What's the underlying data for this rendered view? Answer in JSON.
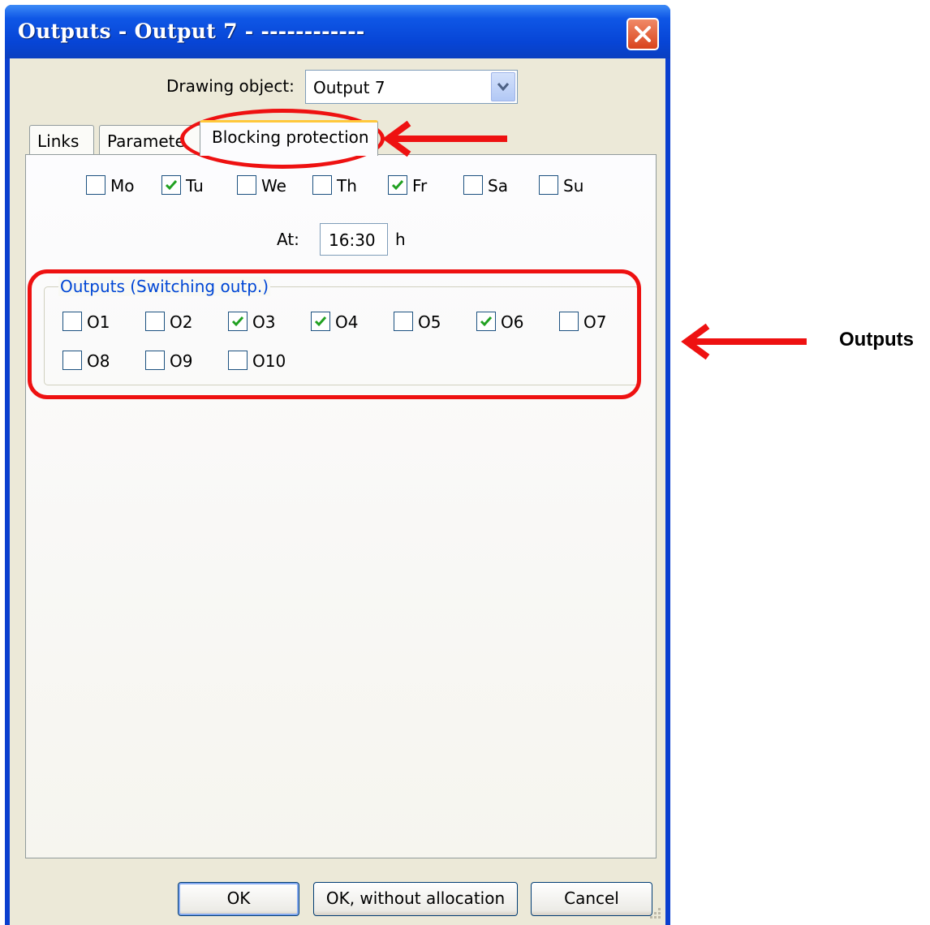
{
  "window": {
    "title": "Outputs - Output 7 - ------------"
  },
  "drawing_object": {
    "label": "Drawing object:",
    "value": "Output 7"
  },
  "tabs": [
    {
      "label": "Links"
    },
    {
      "label": "Paramete"
    },
    {
      "label": "Blocking protection",
      "active": true
    }
  ],
  "days": [
    {
      "label": "Mo",
      "checked": false
    },
    {
      "label": "Tu",
      "checked": true
    },
    {
      "label": "We",
      "checked": false
    },
    {
      "label": "Th",
      "checked": false
    },
    {
      "label": "Fr",
      "checked": true
    },
    {
      "label": "Sa",
      "checked": false
    },
    {
      "label": "Su",
      "checked": false
    }
  ],
  "time": {
    "label": "At:",
    "value": "16:30",
    "unit": "h"
  },
  "outputs_group": {
    "legend": "Outputs (Switching outp.)",
    "items": [
      {
        "label": "O1",
        "checked": false
      },
      {
        "label": "O2",
        "checked": false
      },
      {
        "label": "O3",
        "checked": true
      },
      {
        "label": "O4",
        "checked": true
      },
      {
        "label": "O5",
        "checked": false
      },
      {
        "label": "O6",
        "checked": true
      },
      {
        "label": "O7",
        "checked": false
      },
      {
        "label": "O8",
        "checked": false
      },
      {
        "label": "O9",
        "checked": false
      },
      {
        "label": "O10",
        "checked": false
      }
    ]
  },
  "buttons": {
    "ok": "OK",
    "ok_without": "OK, without allocation",
    "cancel": "Cancel"
  },
  "annotation": {
    "side_label": "Outputs",
    "color": "#ee1111"
  },
  "colors": {
    "titlebar": "#0745d6",
    "group_legend": "#0046d5",
    "check": "#21a121"
  }
}
